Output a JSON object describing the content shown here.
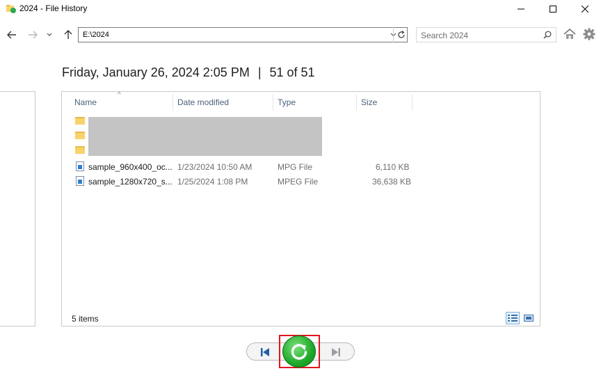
{
  "window": {
    "title": "2024 - File History",
    "minimize": "—",
    "maximize": "☐",
    "close": "✕"
  },
  "nav": {
    "back_icon": "arrow-left-icon",
    "forward_icon": "arrow-right-icon",
    "recent_icon": "chevron-down-icon",
    "up_icon": "arrow-up-icon",
    "address": "E:\\2024",
    "search_placeholder": "Search 2024"
  },
  "snapshot": {
    "datetime": "Friday, January 26, 2024 2:05 PM",
    "separator": "|",
    "position": "51 of 51"
  },
  "columns": [
    "Name",
    "Date modified",
    "Type",
    "Size"
  ],
  "files": [
    {
      "name": "sample_960x400_oc...",
      "date": "1/23/2024 10:50 AM",
      "type": "MPG File",
      "size": "6,110 KB"
    },
    {
      "name": "sample_1280x720_s...",
      "date": "1/25/2024 1:08 PM",
      "type": "MPEG File",
      "size": "36,638 KB"
    }
  ],
  "status": {
    "item_count": "5 items"
  },
  "colors": {
    "restore_green": "#1fa82a",
    "highlight_red": "#e2141c",
    "nav_blue": "#1e5fa8"
  }
}
